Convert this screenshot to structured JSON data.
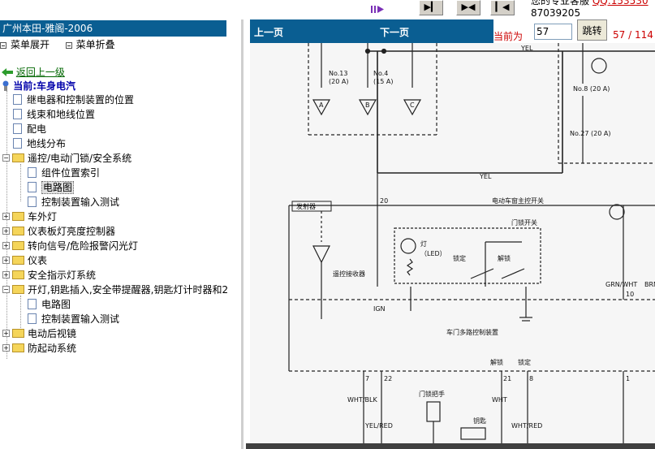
{
  "toolbar": {
    "note_line1": "您的专业客服",
    "note_qq": "QQ:153530",
    "note_line2": "87039205"
  },
  "tree": {
    "title": "广州本田-雅阁-2006",
    "expand_all": "菜单展开",
    "collapse_all": "菜单折叠",
    "back_link": "返回上一级",
    "current_prefix": "当前:",
    "current_name": "车身电汽",
    "items": [
      {
        "label": "继电器和控制装置的位置"
      },
      {
        "label": "线束和地线位置"
      },
      {
        "label": "配电"
      },
      {
        "label": "地线分布"
      },
      {
        "label": "遥控/电动门锁/安全系统"
      },
      {
        "label": "组件位置索引"
      },
      {
        "label": "电路图"
      },
      {
        "label": "控制装置输入测试"
      },
      {
        "label": "车外灯"
      },
      {
        "label": "仪表板灯亮度控制器"
      },
      {
        "label": "转向信号/危险报警闪光灯"
      },
      {
        "label": "仪表"
      },
      {
        "label": "安全指示灯系统"
      },
      {
        "label": "开灯,钥匙插入,安全带提醒器,钥匙灯计时器和2"
      },
      {
        "label": "电路图"
      },
      {
        "label": "控制装置输入测试"
      },
      {
        "label": "电动后视镜"
      },
      {
        "label": "防起动系统"
      }
    ]
  },
  "nav": {
    "prev": "上一页",
    "next": "下一页",
    "current_label": "当前为",
    "page_value": "57",
    "goto": "跳转",
    "page_count": "57 / 114"
  },
  "diagram": {
    "fuse13": "No.13",
    "fuse13_amp": "(20 A)",
    "fuse4": "No.4",
    "fuse4_amp": "(15 A)",
    "fuse8": "No.8 (20 A)",
    "fuse27": "No.27 (20 A)",
    "conn_a": "A",
    "conn_b": "B",
    "conn_c": "C",
    "yel": "YEL",
    "yel2": "YEL",
    "transmitter": "发射器",
    "pin20": "20",
    "master_switch": "电动车窗主控开关",
    "door_switch": "门锁开关",
    "lamp": "灯",
    "led": "（LED）",
    "lock": "锁定",
    "unlock": "解锁",
    "remote_receiver": "遥控接收器",
    "grn_wht": "GRN/WHT",
    "brn": "BRN",
    "pin10": "10",
    "ign": "IGN",
    "multiplex_unit": "车门多路控制装置",
    "unlock2": "解锁",
    "lock2": "锁定",
    "pin7": "7",
    "pin22": "22",
    "pin21": "21",
    "pin8": "8",
    "pin1": "1",
    "wht_blk": "WHT/BLK",
    "wht": "WHT",
    "door_handle": "门锁把手",
    "key": "钥匙",
    "yel_red": "YEL/RED",
    "wht_red": "WHT/RED"
  }
}
